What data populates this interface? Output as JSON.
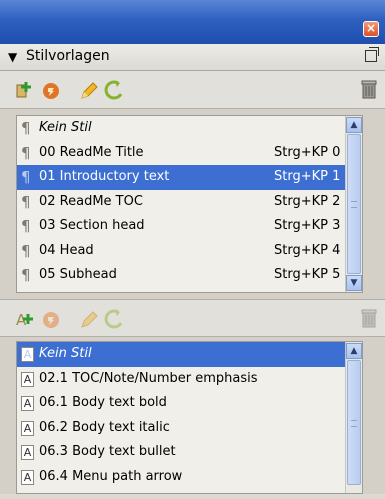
{
  "panel": {
    "title": "Stilvorlagen",
    "close_icon": "close-icon",
    "menu_icon": "panel-menu-icon"
  },
  "paragraph_styles": {
    "toolbar": [
      "new-style-icon",
      "load-styles-icon",
      "edit-style-icon",
      "update-style-icon",
      "delete-style-icon"
    ],
    "items": [
      {
        "name": "Kein Stil",
        "shortcut": ""
      },
      {
        "name": "00 ReadMe Title",
        "shortcut": "Strg+KP 0"
      },
      {
        "name": "01 Introductory text",
        "shortcut": "Strg+KP 1"
      },
      {
        "name": "02 ReadMe TOC",
        "shortcut": "Strg+KP 2"
      },
      {
        "name": "03 Section head",
        "shortcut": "Strg+KP 3"
      },
      {
        "name": "04 Head",
        "shortcut": "Strg+KP 4"
      },
      {
        "name": "05 Subhead",
        "shortcut": "Strg+KP 5"
      }
    ]
  },
  "character_styles": {
    "toolbar": [
      "new-char-style-icon",
      "load-styles-icon",
      "edit-style-icon",
      "update-style-icon",
      "delete-style-icon"
    ],
    "items": [
      {
        "name": "Kein Stil"
      },
      {
        "name": "02.1 TOC/Note/Number emphasis"
      },
      {
        "name": "06.1 Body text bold"
      },
      {
        "name": "06.2 Body text italic"
      },
      {
        "name": "06.3 Body text bullet"
      },
      {
        "name": "06.4 Menu path arrow"
      }
    ]
  },
  "colors": {
    "accent": "#3c6fd1",
    "titlebar": "#2f5fbf"
  }
}
